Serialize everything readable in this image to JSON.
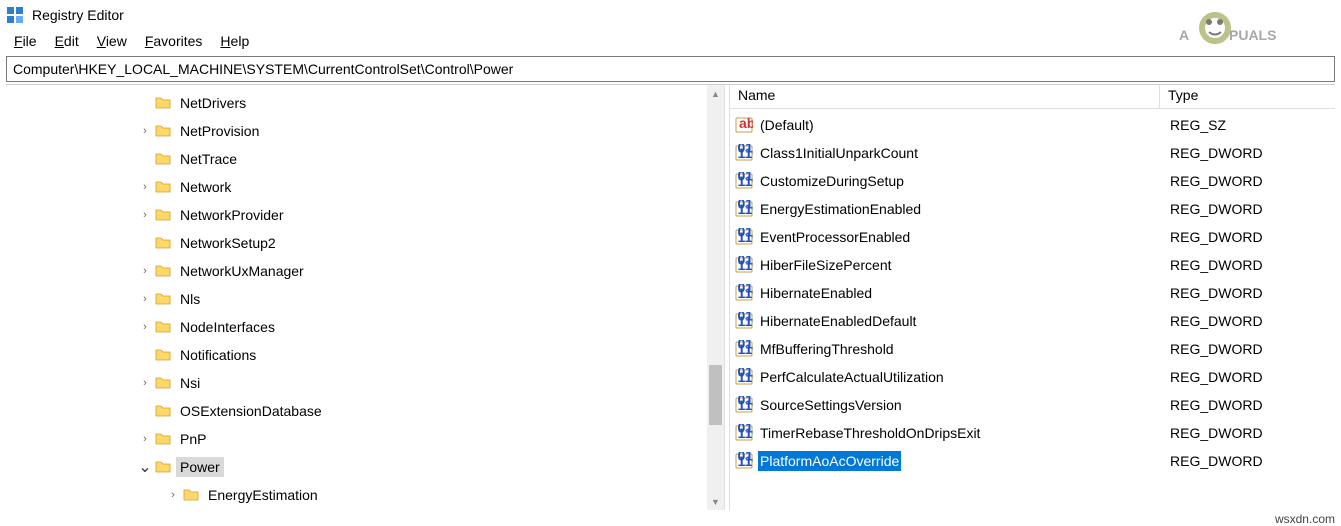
{
  "window": {
    "title": "Registry Editor"
  },
  "menu": {
    "file": "File",
    "edit": "Edit",
    "view": "View",
    "favorites": "Favorites",
    "help": "Help"
  },
  "address": "Computer\\HKEY_LOCAL_MACHINE\\SYSTEM\\CurrentControlSet\\Control\\Power",
  "tree": {
    "items": [
      {
        "indent": 130,
        "expander": "",
        "label": "NetDrivers"
      },
      {
        "indent": 130,
        "expander": ">",
        "label": "NetProvision"
      },
      {
        "indent": 130,
        "expander": "",
        "label": "NetTrace"
      },
      {
        "indent": 130,
        "expander": ">",
        "label": "Network"
      },
      {
        "indent": 130,
        "expander": ">",
        "label": "NetworkProvider"
      },
      {
        "indent": 130,
        "expander": "",
        "label": "NetworkSetup2"
      },
      {
        "indent": 130,
        "expander": ">",
        "label": "NetworkUxManager"
      },
      {
        "indent": 130,
        "expander": ">",
        "label": "Nls"
      },
      {
        "indent": 130,
        "expander": ">",
        "label": "NodeInterfaces"
      },
      {
        "indent": 130,
        "expander": "",
        "label": "Notifications"
      },
      {
        "indent": 130,
        "expander": ">",
        "label": "Nsi"
      },
      {
        "indent": 130,
        "expander": "",
        "label": "OSExtensionDatabase"
      },
      {
        "indent": 130,
        "expander": ">",
        "label": "PnP"
      },
      {
        "indent": 130,
        "expander": "v",
        "label": "Power",
        "selected": true
      },
      {
        "indent": 158,
        "expander": ">",
        "label": "EnergyEstimation"
      }
    ]
  },
  "list": {
    "cols": {
      "name": "Name",
      "type": "Type"
    },
    "rows": [
      {
        "icon": "ab",
        "name": "(Default)",
        "type": "REG_SZ"
      },
      {
        "icon": "num",
        "name": "Class1InitialUnparkCount",
        "type": "REG_DWORD"
      },
      {
        "icon": "num",
        "name": "CustomizeDuringSetup",
        "type": "REG_DWORD"
      },
      {
        "icon": "num",
        "name": "EnergyEstimationEnabled",
        "type": "REG_DWORD"
      },
      {
        "icon": "num",
        "name": "EventProcessorEnabled",
        "type": "REG_DWORD"
      },
      {
        "icon": "num",
        "name": "HiberFileSizePercent",
        "type": "REG_DWORD"
      },
      {
        "icon": "num",
        "name": "HibernateEnabled",
        "type": "REG_DWORD"
      },
      {
        "icon": "num",
        "name": "HibernateEnabledDefault",
        "type": "REG_DWORD"
      },
      {
        "icon": "num",
        "name": "MfBufferingThreshold",
        "type": "REG_DWORD"
      },
      {
        "icon": "num",
        "name": "PerfCalculateActualUtilization",
        "type": "REG_DWORD"
      },
      {
        "icon": "num",
        "name": "SourceSettingsVersion",
        "type": "REG_DWORD"
      },
      {
        "icon": "num",
        "name": "TimerRebaseThresholdOnDripsExit",
        "type": "REG_DWORD"
      },
      {
        "icon": "num",
        "name": "PlatformAoAcOverride",
        "type": "REG_DWORD",
        "selected": true
      }
    ]
  },
  "watermark": "Appuals",
  "footer": "wsxdn.com"
}
